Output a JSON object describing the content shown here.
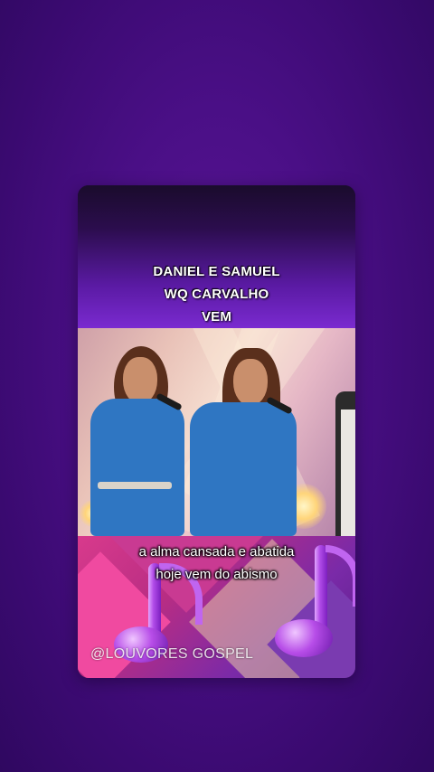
{
  "video": {
    "title_lines": [
      "DANIEL E SAMUEL",
      "WQ CARVALHO",
      "VEM"
    ],
    "subtitle_lines": [
      "a alma cansada e abatida",
      "hoje vem do abismo"
    ],
    "watermark": "@LOUVORES GOSPEL"
  },
  "colors": {
    "background": "#4a0f86",
    "header_gradient_end": "#7a2ad0",
    "shirt_blue": "#2f76c2",
    "art_pink": "#d83a8c"
  },
  "icons": [
    "music-note-icon"
  ]
}
